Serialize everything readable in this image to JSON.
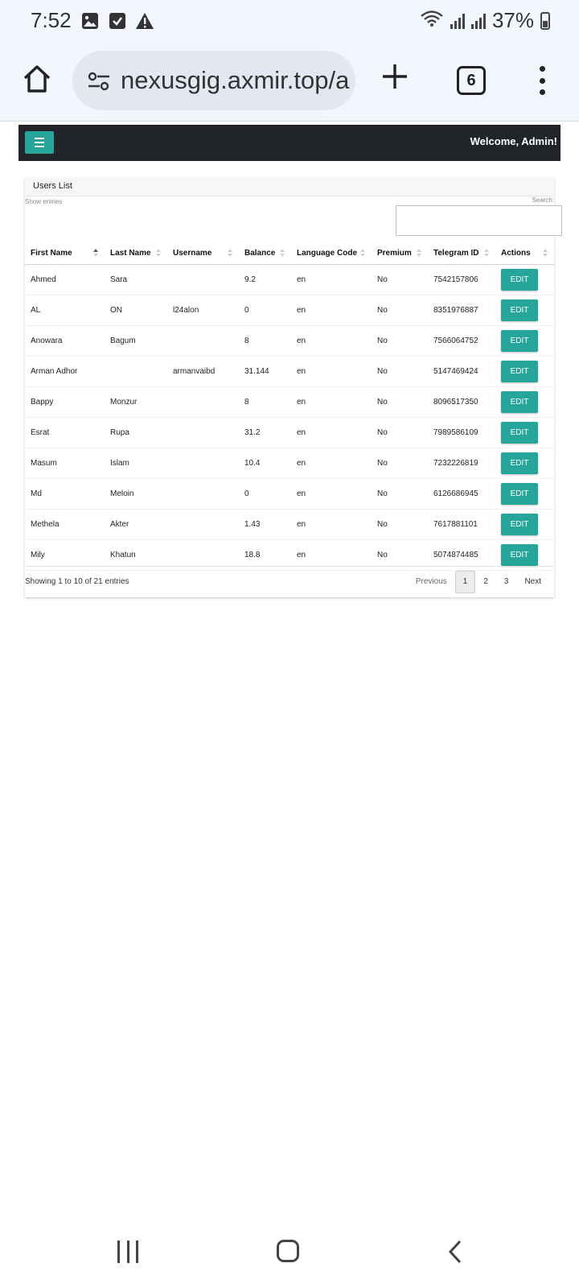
{
  "status_bar": {
    "time": "7:52",
    "battery": "37%",
    "icons": [
      "image-icon",
      "checkbox-icon",
      "warning-icon",
      "wifi-icon",
      "signal-icon",
      "signal-icon",
      "battery-icon"
    ]
  },
  "browser": {
    "url": "nexusgig.axmir.top/a",
    "tab_count": "6"
  },
  "header": {
    "welcome": "Welcome, Admin!",
    "accent_color": "#26a69a",
    "bar_color": "#212529"
  },
  "users_card": {
    "title": "Users List",
    "show_entries": "Show entries",
    "search_label": "Search:",
    "search_value": "",
    "columns": [
      "First Name",
      "Last Name",
      "Username",
      "Balance",
      "Language Code",
      "Premium",
      "Telegram ID",
      "Actions"
    ],
    "sorted_column": "First Name",
    "rows": [
      {
        "first_name": "Ahmed",
        "last_name": "Sara",
        "username": "",
        "balance": "9.2",
        "language": "en",
        "premium": "No",
        "telegram_id": "7542157806",
        "action": "EDIT"
      },
      {
        "first_name": "AL",
        "last_name": "ON",
        "username": "l24alon",
        "balance": "0",
        "language": "en",
        "premium": "No",
        "telegram_id": "8351976887",
        "action": "EDIT"
      },
      {
        "first_name": "Anowara",
        "last_name": "Bagum",
        "username": "",
        "balance": "8",
        "language": "en",
        "premium": "No",
        "telegram_id": "7566064752",
        "action": "EDIT"
      },
      {
        "first_name": "Arman Adhor",
        "last_name": "",
        "username": "armanvaibd",
        "balance": "31.144",
        "language": "en",
        "premium": "No",
        "telegram_id": "5147469424",
        "action": "EDIT"
      },
      {
        "first_name": "Bappy",
        "last_name": "Monzur",
        "username": "",
        "balance": "8",
        "language": "en",
        "premium": "No",
        "telegram_id": "8096517350",
        "action": "EDIT"
      },
      {
        "first_name": "Esrat",
        "last_name": "Rupa",
        "username": "",
        "balance": "31.2",
        "language": "en",
        "premium": "No",
        "telegram_id": "7989586109",
        "action": "EDIT"
      },
      {
        "first_name": "Masum",
        "last_name": "Islam",
        "username": "",
        "balance": "10.4",
        "language": "en",
        "premium": "No",
        "telegram_id": "7232226819",
        "action": "EDIT"
      },
      {
        "first_name": "Md",
        "last_name": "Meloin",
        "username": "",
        "balance": "0",
        "language": "en",
        "premium": "No",
        "telegram_id": "6126686945",
        "action": "EDIT"
      },
      {
        "first_name": "Methela",
        "last_name": "Akter",
        "username": "",
        "balance": "1.43",
        "language": "en",
        "premium": "No",
        "telegram_id": "7617881101",
        "action": "EDIT"
      },
      {
        "first_name": "Mily",
        "last_name": "Khatun",
        "username": "",
        "balance": "18.8",
        "language": "en",
        "premium": "No",
        "telegram_id": "5074874485",
        "action": "EDIT"
      }
    ],
    "showing_text": "Showing 1 to 10 of 21 entries",
    "pagination": {
      "previous": "Previous",
      "pages": [
        "1",
        "2",
        "3"
      ],
      "current_page": "1",
      "next": "Next"
    }
  },
  "nav_bar": {
    "icons": [
      "recent-apps-icon",
      "home-icon",
      "back-icon"
    ]
  }
}
